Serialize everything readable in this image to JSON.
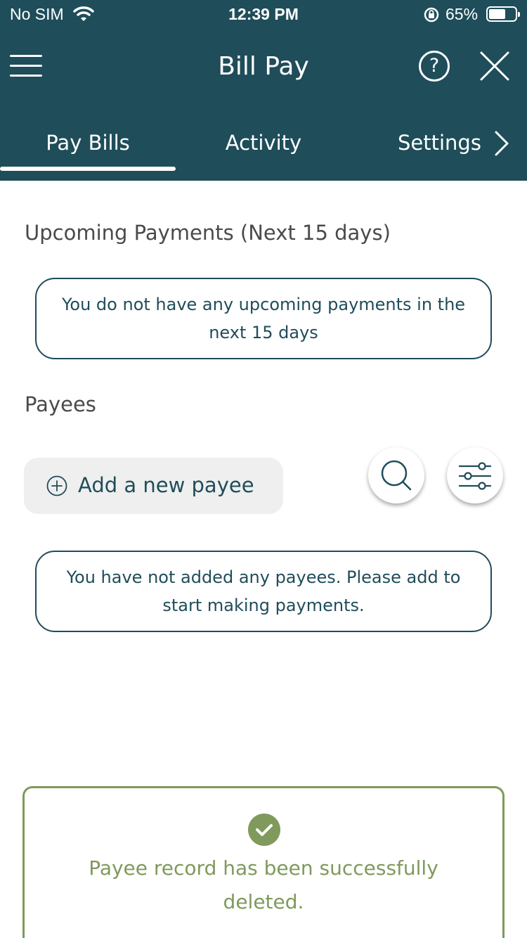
{
  "status_bar": {
    "carrier": "No SIM",
    "time": "12:39 PM",
    "battery_percent": "65%",
    "battery_level": 0.65
  },
  "nav": {
    "title": "Bill Pay",
    "help_symbol": "?",
    "menu_icon": "hamburger-menu-icon",
    "close_icon": "close-icon"
  },
  "tabs": [
    {
      "label": "Pay Bills",
      "active": true
    },
    {
      "label": "Activity",
      "active": false
    },
    {
      "label": "Settings",
      "active": false
    }
  ],
  "upcoming": {
    "title": "Upcoming Payments  (Next 15 days)",
    "empty_message": "You do not have any upcoming payments in the next 15 days"
  },
  "payees": {
    "title": "Payees",
    "add_label": "Add a new payee",
    "empty_message": "You have not added any payees. Please add to start making payments."
  },
  "toast": {
    "message": "Payee record has been successfully deleted."
  },
  "colors": {
    "brand": "#1f4d5a",
    "success": "#7f9a5c",
    "button_bg": "#efefef"
  }
}
